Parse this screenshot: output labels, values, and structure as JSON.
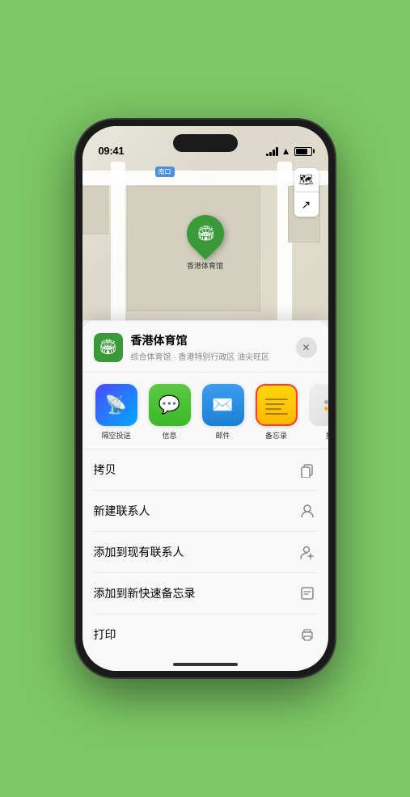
{
  "statusBar": {
    "time": "09:41",
    "showLocationArrow": true
  },
  "map": {
    "label": "南口",
    "locationName": "香港体育馆",
    "controls": {
      "mapIcon": "🗺",
      "locationIcon": "⬆"
    }
  },
  "bottomSheet": {
    "venueName": "香港体育馆",
    "venueSubtitle": "综合体育馆 · 香港特别行政区 油尖旺区",
    "closeLabel": "×",
    "shareApps": [
      {
        "id": "airdrop",
        "label": "隔空投送",
        "type": "airdrop"
      },
      {
        "id": "messages",
        "label": "信息",
        "type": "messages"
      },
      {
        "id": "mail",
        "label": "邮件",
        "type": "mail"
      },
      {
        "id": "notes",
        "label": "备忘录",
        "type": "notes",
        "selected": true
      },
      {
        "id": "more",
        "label": "推",
        "type": "more"
      }
    ],
    "actions": [
      {
        "id": "copy",
        "label": "拷贝",
        "iconType": "copy"
      },
      {
        "id": "new-contact",
        "label": "新建联系人",
        "iconType": "person"
      },
      {
        "id": "add-existing",
        "label": "添加到现有联系人",
        "iconType": "person-add"
      },
      {
        "id": "add-notes",
        "label": "添加到新快速备忘录",
        "iconType": "note"
      },
      {
        "id": "print",
        "label": "打印",
        "iconType": "printer"
      }
    ]
  }
}
